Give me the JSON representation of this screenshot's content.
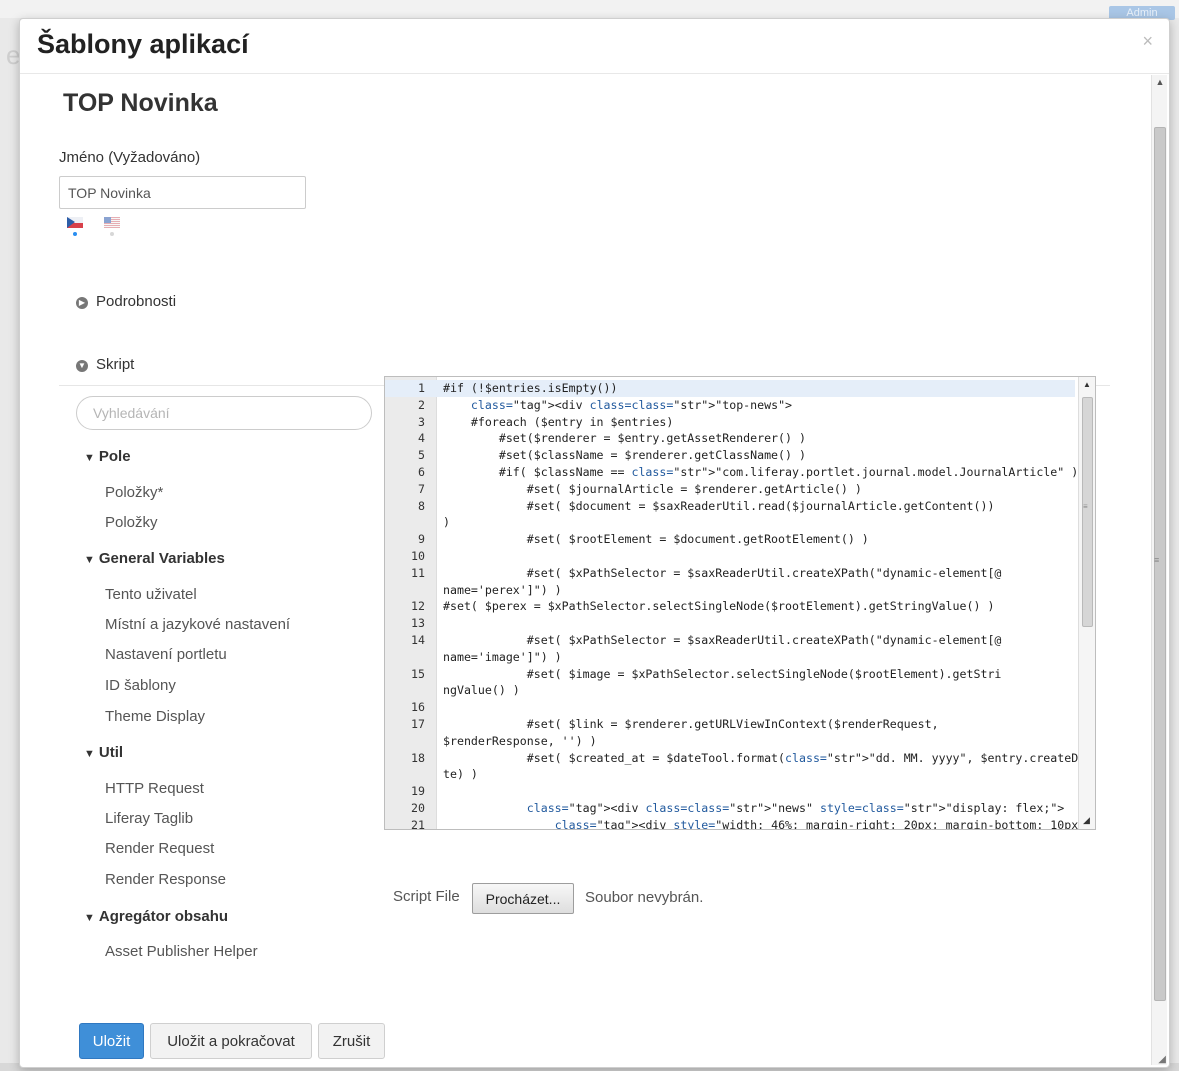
{
  "background": {
    "admin_label": "Admin",
    "left_letter": "e"
  },
  "modal": {
    "title": "Šablony aplikací",
    "close_symbol": "×"
  },
  "entry": {
    "title": "TOP Novinka",
    "name_label": "Jméno (Vyžadováno)",
    "name_value": "TOP Novinka",
    "languages": [
      "cs_CZ",
      "en_US"
    ]
  },
  "panels": {
    "details": "Podrobnosti",
    "script": "Skript"
  },
  "palette": {
    "search_placeholder": "Vyhledávání",
    "groups": [
      {
        "label": "Pole",
        "items": [
          "Položky*",
          "Položky"
        ]
      },
      {
        "label": "General Variables",
        "items": [
          "Tento uživatel",
          "Místní a jazykové nastavení",
          "Nastavení portletu",
          "ID šablony",
          "Theme Display"
        ]
      },
      {
        "label": "Util",
        "items": [
          "HTTP Request",
          "Liferay Taglib",
          "Render Request",
          "Render Response"
        ]
      },
      {
        "label": "Agregátor obsahu",
        "items": [
          "Asset Publisher Helper"
        ]
      }
    ]
  },
  "editor": {
    "lines": [
      {
        "n": "1",
        "t": "#if (!$entries.isEmpty())"
      },
      {
        "n": "2",
        "t": "    <div class=\"top-news\">"
      },
      {
        "n": "3",
        "t": "    #foreach ($entry in $entries)"
      },
      {
        "n": "4",
        "t": "        #set($renderer = $entry.getAssetRenderer() )"
      },
      {
        "n": "5",
        "t": "        #set($className = $renderer.getClassName() )"
      },
      {
        "n": "6",
        "t": "        #if( $className == \"com.liferay.portlet.journal.model.JournalArticle\" )"
      },
      {
        "n": "7",
        "t": "            #set( $journalArticle = $renderer.getArticle() )"
      },
      {
        "n": "8",
        "t": "            #set( $document = $saxReaderUtil.read($journalArticle.getContent())"
      },
      {
        "n": "",
        "t": ")"
      },
      {
        "n": "9",
        "t": "            #set( $rootElement = $document.getRootElement() )"
      },
      {
        "n": "10",
        "t": ""
      },
      {
        "n": "11",
        "t": "            #set( $xPathSelector = $saxReaderUtil.createXPath(\"dynamic-element[@"
      },
      {
        "n": "",
        "t": "name='perex']\") )"
      },
      {
        "n": "12",
        "t": "#set( $perex = $xPathSelector.selectSingleNode($rootElement).getStringValue() )"
      },
      {
        "n": "13",
        "t": ""
      },
      {
        "n": "14",
        "t": "            #set( $xPathSelector = $saxReaderUtil.createXPath(\"dynamic-element[@"
      },
      {
        "n": "",
        "t": "name='image']\") )"
      },
      {
        "n": "15",
        "t": "            #set( $image = $xPathSelector.selectSingleNode($rootElement).getStri"
      },
      {
        "n": "",
        "t": "ngValue() )"
      },
      {
        "n": "16",
        "t": ""
      },
      {
        "n": "17",
        "t": "            #set( $link = $renderer.getURLViewInContext($renderRequest,"
      },
      {
        "n": "",
        "t": "$renderResponse, '') )"
      },
      {
        "n": "18",
        "t": "            #set( $created_at = $dateTool.format(\"dd. MM. yyyy\", $entry.createDa"
      },
      {
        "n": "",
        "t": "te) )"
      },
      {
        "n": "19",
        "t": ""
      },
      {
        "n": "20",
        "t": "            <div class=\"news\" style=\"display: flex;\">"
      },
      {
        "n": "21",
        "t": "                <div style=\"width: 46%; margin-right: 20px; margin-bottom: 10px"
      }
    ]
  },
  "script_file": {
    "label": "Script File",
    "browse_label": "Procházet...",
    "status": "Soubor nevybrán."
  },
  "buttons": {
    "save": "Uložit",
    "save_continue": "Uložit a pokračovat",
    "cancel": "Zrušit"
  },
  "colors": {
    "primary": "#3f8fd8",
    "editor_string": "#1a8a2e",
    "editor_tag": "#225a9e"
  }
}
